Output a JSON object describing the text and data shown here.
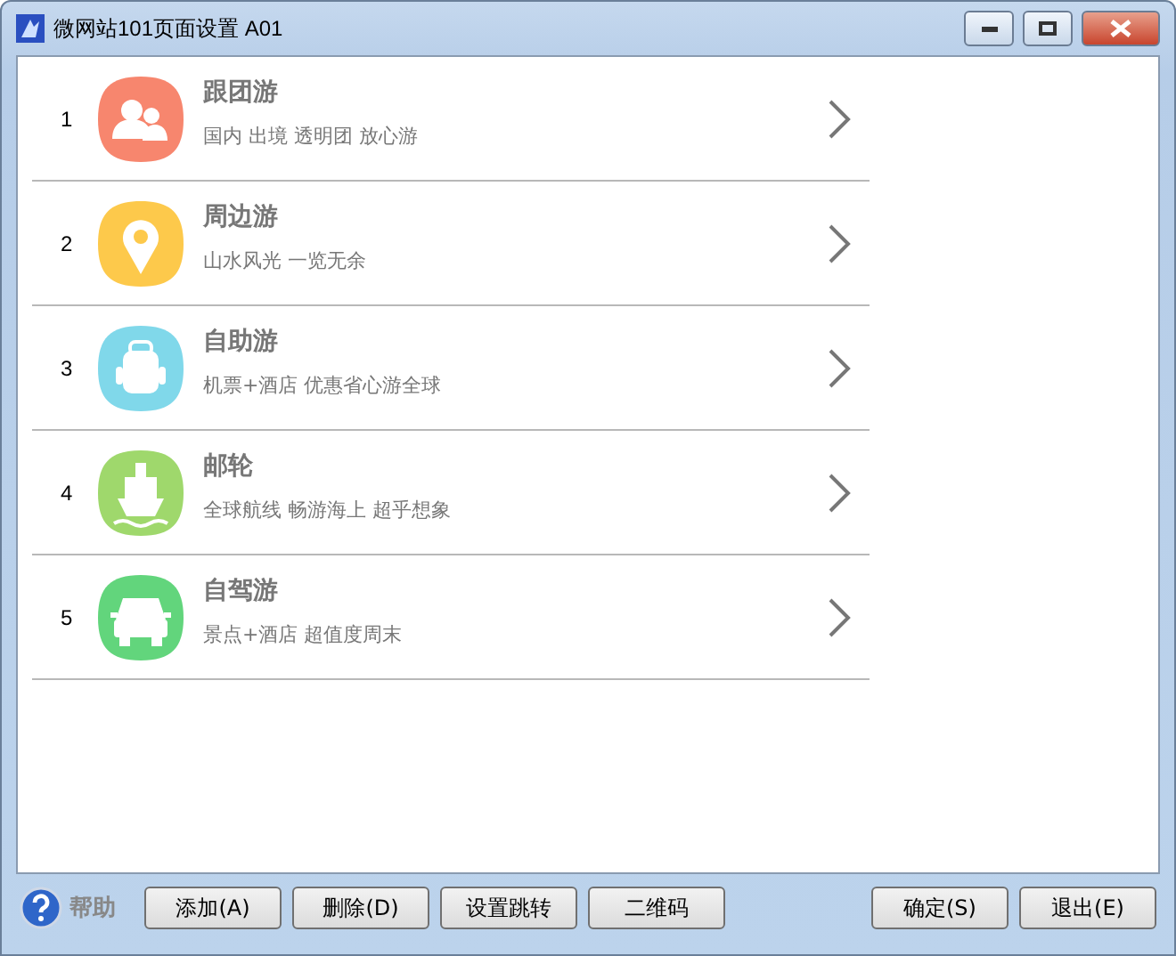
{
  "window": {
    "title": "微网站101页面设置 A01"
  },
  "items": [
    {
      "number": "1",
      "title": "跟团游",
      "subtitle": "国内 出境 透明团 放心游",
      "kind": "group",
      "color": "#f7866e"
    },
    {
      "number": "2",
      "title": "周边游",
      "subtitle": "山水风光 一览无余",
      "kind": "pin",
      "color": "#fdc94b"
    },
    {
      "number": "3",
      "title": "自助游",
      "subtitle": "机票+酒店 优惠省心游全球",
      "kind": "backpack",
      "color": "#80d8ea"
    },
    {
      "number": "4",
      "title": "邮轮",
      "subtitle": "全球航线 畅游海上 超乎想象",
      "kind": "ship",
      "color": "#9fd86c"
    },
    {
      "number": "5",
      "title": "自驾游",
      "subtitle": "景点+酒店 超值度周末",
      "kind": "car",
      "color": "#62d57c"
    }
  ],
  "help": "帮助",
  "buttons_left": [
    "添加(A)",
    "删除(D)",
    "设置跳转",
    "二维码"
  ],
  "buttons_right": [
    "确定(S)",
    "退出(E)"
  ]
}
